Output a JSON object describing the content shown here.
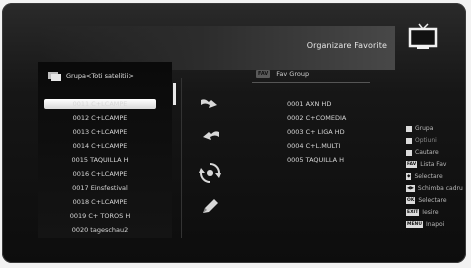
{
  "title": "Organizare Favorite",
  "group_header": "Grupa<Toti satelitii>",
  "channels": [
    {
      "label": "0011 C+LCAMPE",
      "selected": true
    },
    {
      "label": "0012 C+LCAMPE"
    },
    {
      "label": "0013 C+LCAMPE"
    },
    {
      "label": "0014 C+LCAMPE"
    },
    {
      "label": "0015 TAQUILLA H"
    },
    {
      "label": "0016 C+LCAMPE"
    },
    {
      "label": "0017 Einsfestival"
    },
    {
      "label": "0018 C+LCAMPE"
    },
    {
      "label": "0019 C+ TOROS H"
    },
    {
      "label": "0020 tageschau2"
    }
  ],
  "fav_group": {
    "badge": "FAV",
    "label": "Fav Group",
    "items": [
      "0001 AXN HD",
      "0002 C+COMEDIA",
      "0003 C+ LIGA HD",
      "0004 C+L.MULTI",
      "0005 TAQUILLA H"
    ]
  },
  "actions": [
    "move-icon",
    "undo-icon",
    "swap-icon",
    "edit-icon"
  ],
  "legend": [
    {
      "key": "",
      "label": "Grupa",
      "style": "square"
    },
    {
      "key": "",
      "label": "Optiuni",
      "style": "square-dim"
    },
    {
      "key": "",
      "label": "Cautare",
      "style": "square"
    },
    {
      "key": "FAV",
      "label": "Lista Fav"
    },
    {
      "key": "◆",
      "label": "Selectare"
    },
    {
      "key": "◀▶",
      "label": "Schimba cadru"
    },
    {
      "key": "OK",
      "label": "Selectare"
    },
    {
      "key": "EXIT",
      "label": "Iesire"
    },
    {
      "key": "MENU",
      "label": "Inapoi"
    }
  ]
}
